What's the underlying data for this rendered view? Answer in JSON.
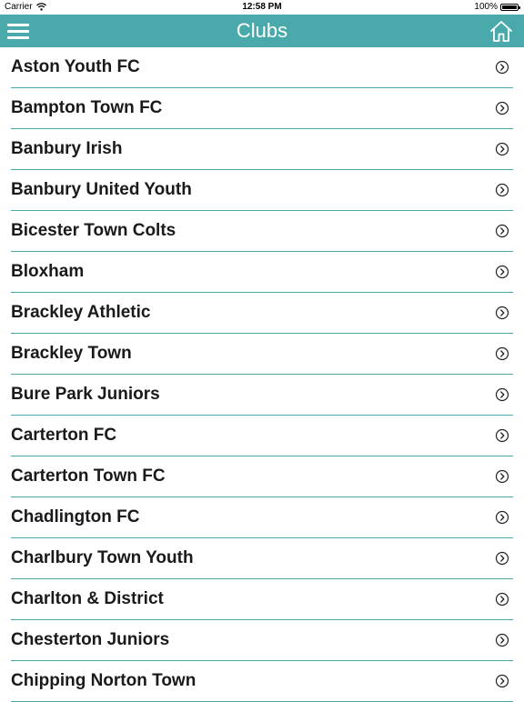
{
  "status_bar": {
    "carrier": "Carrier",
    "time": "12:58 PM",
    "battery": "100%"
  },
  "nav": {
    "title": "Clubs",
    "menu_icon": "hamburger-menu-icon",
    "home_icon": "home-icon",
    "color": "#4aa9aa"
  },
  "clubs": [
    {
      "label": "Aston Youth FC"
    },
    {
      "label": "Bampton Town FC"
    },
    {
      "label": "Banbury Irish"
    },
    {
      "label": "Banbury United Youth"
    },
    {
      "label": "Bicester Town Colts"
    },
    {
      "label": "Bloxham"
    },
    {
      "label": "Brackley Athletic"
    },
    {
      "label": "Brackley Town"
    },
    {
      "label": "Bure Park Juniors"
    },
    {
      "label": "Carterton FC"
    },
    {
      "label": "Carterton Town FC"
    },
    {
      "label": "Chadlington FC"
    },
    {
      "label": "Charlbury Town Youth"
    },
    {
      "label": "Charlton & District"
    },
    {
      "label": "Chesterton Juniors"
    },
    {
      "label": "Chipping Norton Town"
    }
  ]
}
